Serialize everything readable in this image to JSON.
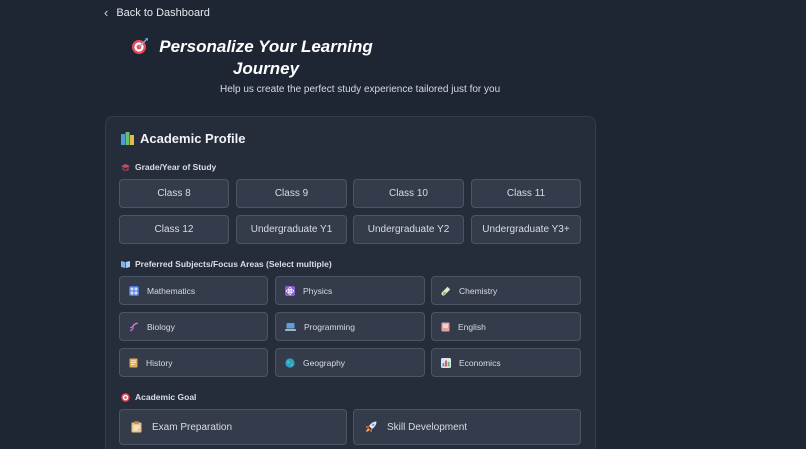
{
  "nav": {
    "back_label": "Back to Dashboard"
  },
  "hero": {
    "title": "Personalize Your Learning Journey",
    "subtitle": "Help us create the perfect study experience tailored just for you"
  },
  "profile": {
    "title": "Academic Profile",
    "grade_label": "Grade/Year of Study",
    "grades": [
      "Class 8",
      "Class 9",
      "Class 10",
      "Class 11",
      "Class 12",
      "Undergraduate Y1",
      "Undergraduate Y2",
      "Undergraduate Y3+"
    ],
    "subjects_label": "Preferred Subjects/Focus Areas (Select multiple)",
    "subjects": [
      {
        "label": "Mathematics",
        "icon": "numbers-icon",
        "color": "#5b7fd6"
      },
      {
        "label": "Physics",
        "icon": "atom-icon",
        "color": "#8f63d1"
      },
      {
        "label": "Chemistry",
        "icon": "test-tube-icon",
        "color": "#7fbf5a"
      },
      {
        "label": "Biology",
        "icon": "dna-icon",
        "color": "#b065c8"
      },
      {
        "label": "Programming",
        "icon": "laptop-icon",
        "color": "#6aa2d8"
      },
      {
        "label": "English",
        "icon": "book-icon",
        "color": "#d98f8f"
      },
      {
        "label": "History",
        "icon": "scroll-icon",
        "color": "#d8a45a"
      },
      {
        "label": "Geography",
        "icon": "globe-icon",
        "color": "#3fa7c9"
      },
      {
        "label": "Economics",
        "icon": "bar-chart-icon",
        "color": "#7d8fb0"
      }
    ],
    "goal_label": "Academic Goal",
    "goals": [
      {
        "label": "Exam Preparation",
        "icon": "clipboard-icon"
      },
      {
        "label": "Skill Development",
        "icon": "rocket-icon"
      }
    ]
  },
  "colors": {
    "background": "#1e2533",
    "card": "#252d3b",
    "option": "#343c4b",
    "option_border": "#4b5566"
  }
}
